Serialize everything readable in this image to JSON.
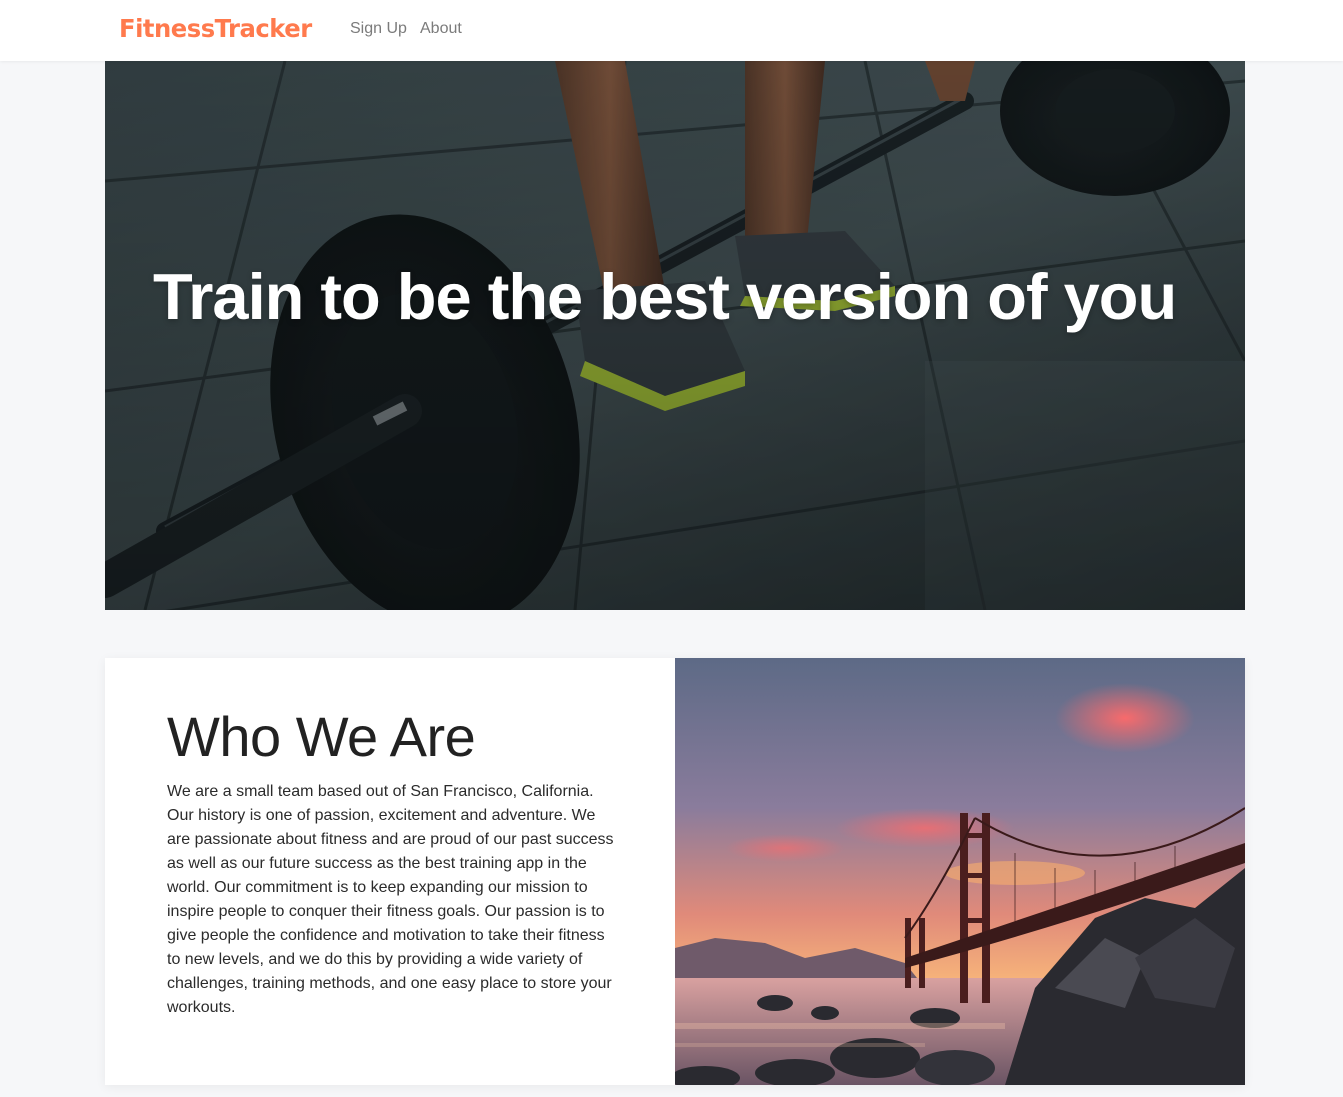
{
  "navbar": {
    "brand": "FitnessTracker",
    "links": [
      "Sign Up",
      "About"
    ]
  },
  "hero": {
    "title": "Train to be the best version of you",
    "image": "barbell-deadlift-photo"
  },
  "about": {
    "heading": "Who We Are",
    "body": "We are a small team based out of San Francisco, California. Our history is one of passion, excitement and adventure. We are passionate about fitness and are proud of our past success as well as our future success as the best training app in the world. Our commitment is to keep expanding our mission to inspire people to conquer their fitness goals. Our passion is to give people the confidence and motivation to take their fitness to new levels, and we do this by providing a wide variety of challenges, training methods, and one easy place to store your workouts.",
    "image": "golden-gate-bridge-sunset-photo"
  },
  "colors": {
    "brand": "#ff7a4d",
    "nav_link": "#7b7b7b",
    "page_background": "#f6f7f9"
  }
}
